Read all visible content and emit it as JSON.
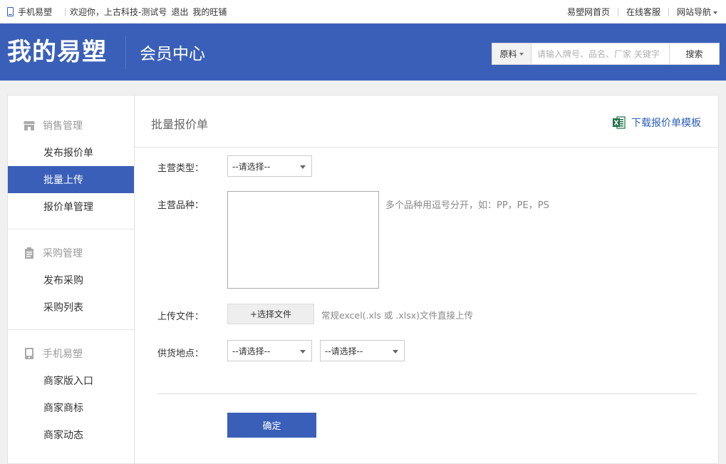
{
  "topbar": {
    "mobile_label": "手机易塑",
    "welcome": "欢迎你，上古科技-测试号",
    "logout": "退出",
    "my_shop": "我的旺铺",
    "home": "易塑网首页",
    "service": "在线客服",
    "site_nav": "网站导航"
  },
  "header": {
    "logo": "我的易塑",
    "subtitle": "会员中心",
    "search_category": "原料",
    "search_placeholder": "请输入牌号、品名、厂家 关键字",
    "search_button": "搜索"
  },
  "sidebar": {
    "groups": [
      {
        "title": "销售管理",
        "icon": "store-icon",
        "items": [
          "发布报价单",
          "批量上传",
          "报价单管理"
        ]
      },
      {
        "title": "采购管理",
        "icon": "clipboard-icon",
        "items": [
          "发布采购",
          "采购列表"
        ]
      },
      {
        "title": "手机易塑",
        "icon": "mobile-icon",
        "items": [
          "商家版入口",
          "商家商标",
          "商家动态"
        ]
      }
    ],
    "active_item": "批量上传"
  },
  "main": {
    "title": "批量报价单",
    "download_label": "下载报价单模板",
    "form": {
      "type_label": "主营类型：",
      "type_value": "--请选择--",
      "variety_label": "主营品种：",
      "variety_hint": "多个品种用逗号分开，如：PP，PE，PS",
      "upload_label": "上传文件：",
      "upload_button": "+选择文件",
      "upload_hint": "常规excel(.xls 或 .xlsx)文件直接上传",
      "location_label": "供货地点：",
      "location_value1": "--请选择--",
      "location_value2": "--请选择--",
      "confirm": "确定"
    }
  },
  "colors": {
    "brand_blue": "#3a5fb8",
    "excel_green": "#1e7145"
  }
}
